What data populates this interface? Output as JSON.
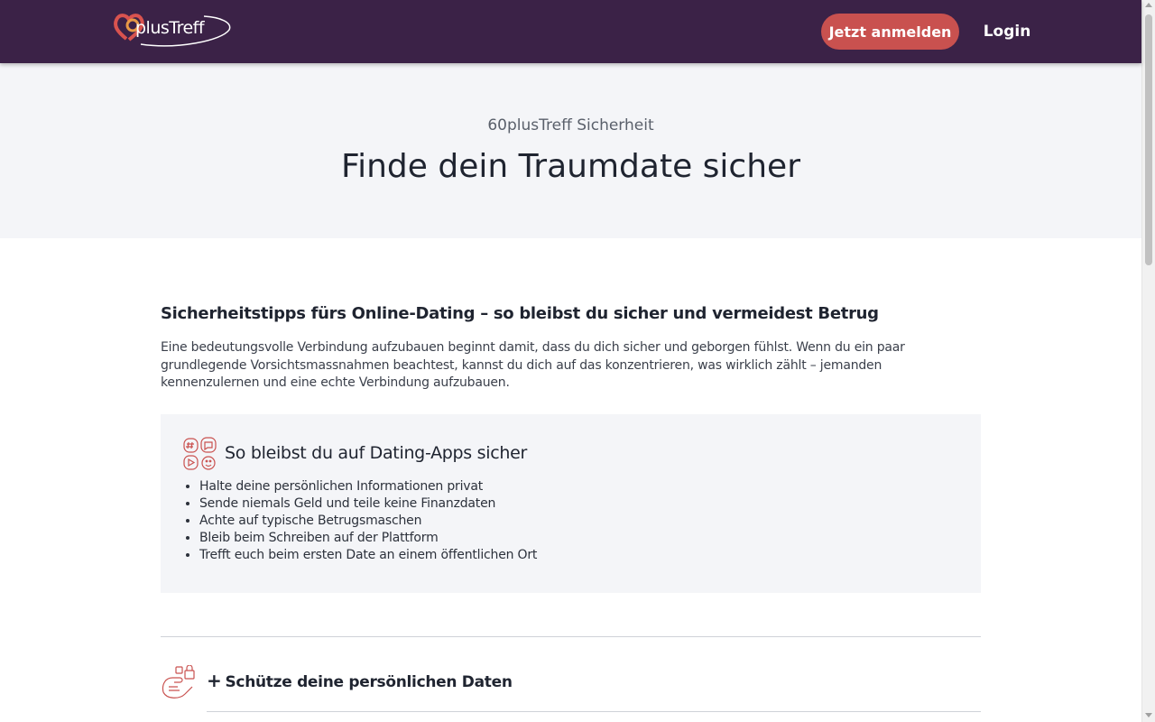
{
  "header": {
    "logo_text": "plusTreff",
    "join_label": "Jetzt anmelden",
    "login_label": "Login"
  },
  "hero": {
    "subtitle": "60plusTreff Sicherheit",
    "title": "Finde dein Traumdate sicher"
  },
  "main": {
    "heading": "Sicherheitstipps fürs Online-Dating – so bleibst du sicher und vermeidest Betrug",
    "intro": "Eine bedeutungsvolle Verbindung aufzubauen beginnt damit, dass du dich sicher und geborgen fühlst. Wenn du ein paar grundlegende Vorsichtsmassnahmen beachtest, kannst du dich auf das konzentrieren, was wirklich zählt – jemanden kennenzulernen und eine echte Verbindung aufzubauen.",
    "tips": {
      "title": "So bleibst du auf Dating-Apps sicher",
      "items": [
        "Halte deine persönlichen Informationen privat",
        "Sende niemals Geld und teile keine Finanzdaten",
        "Achte auf typische Betrugsmaschen",
        "Bleib beim Schreiben auf der Plattform",
        "Trefft euch beim ersten Date an einem öffentlichen Ort"
      ]
    },
    "accordion": {
      "plus": "+",
      "label": "Schütze deine persönlichen Daten"
    }
  },
  "colors": {
    "header_bg": "#3b2247",
    "accent": "#c9514f",
    "hero_bg": "#f4f5f8"
  }
}
